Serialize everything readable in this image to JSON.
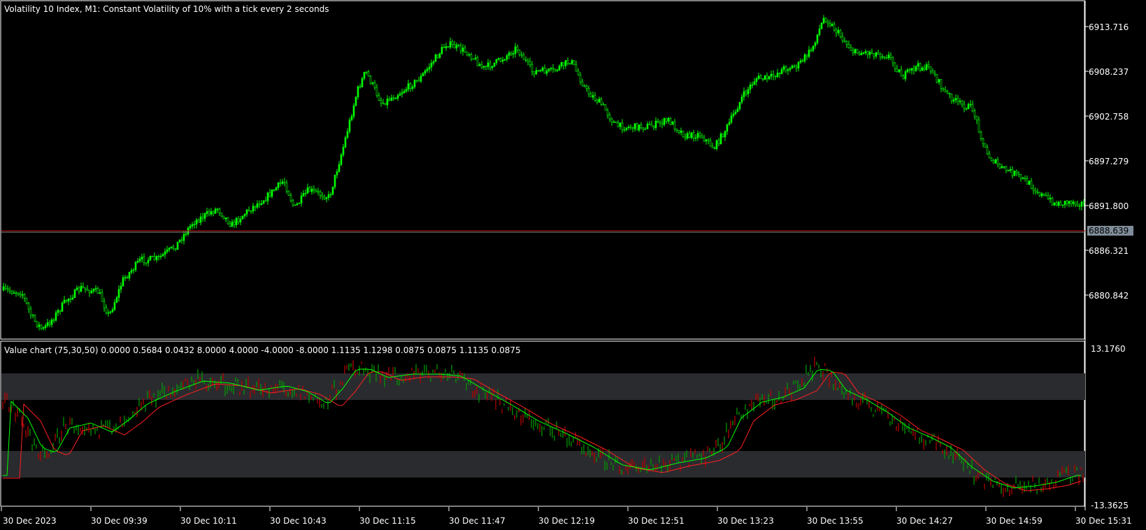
{
  "main_chart": {
    "title": "Volatility 10 Index, M1:  Constant Volatility of 10% with a tick every 2 seconds",
    "price_labels": [
      "6913.716",
      "6908.237",
      "6902.758",
      "6897.279",
      "6891.800",
      "6886.321",
      "6880.842"
    ],
    "current_price": "6888.639",
    "colors": {
      "up": "#00ff00",
      "down": "#00ff00",
      "price_line": "#c00000",
      "tag_bg": "#7f8c99"
    }
  },
  "indicator": {
    "label": "Value chart (75,30,50) 0.0000 0.5684 0.0432 8.0000 4.0000 -4.0000 -8.0000 1.1135 1.1298 0.0875 0.0875 1.1135 0.0875",
    "scale_max": "13.1760",
    "scale_min": "-13.3625",
    "colors": {
      "band": "#2a2b2f",
      "bar_up": "#00b000",
      "bar_down": "#d00000",
      "ma_fast": "#00ff00",
      "ma_slow": "#ff2020"
    }
  },
  "time_axis": {
    "labels": [
      "30 Dec 2023",
      "30 Dec 09:39",
      "30 Dec 10:11",
      "30 Dec 10:43",
      "30 Dec 11:15",
      "30 Dec 11:47",
      "30 Dec 12:19",
      "30 Dec 12:51",
      "30 Dec 13:23",
      "30 Dec 13:55",
      "30 Dec 14:27",
      "30 Dec 14:59",
      "30 Dec 15:31"
    ]
  }
}
